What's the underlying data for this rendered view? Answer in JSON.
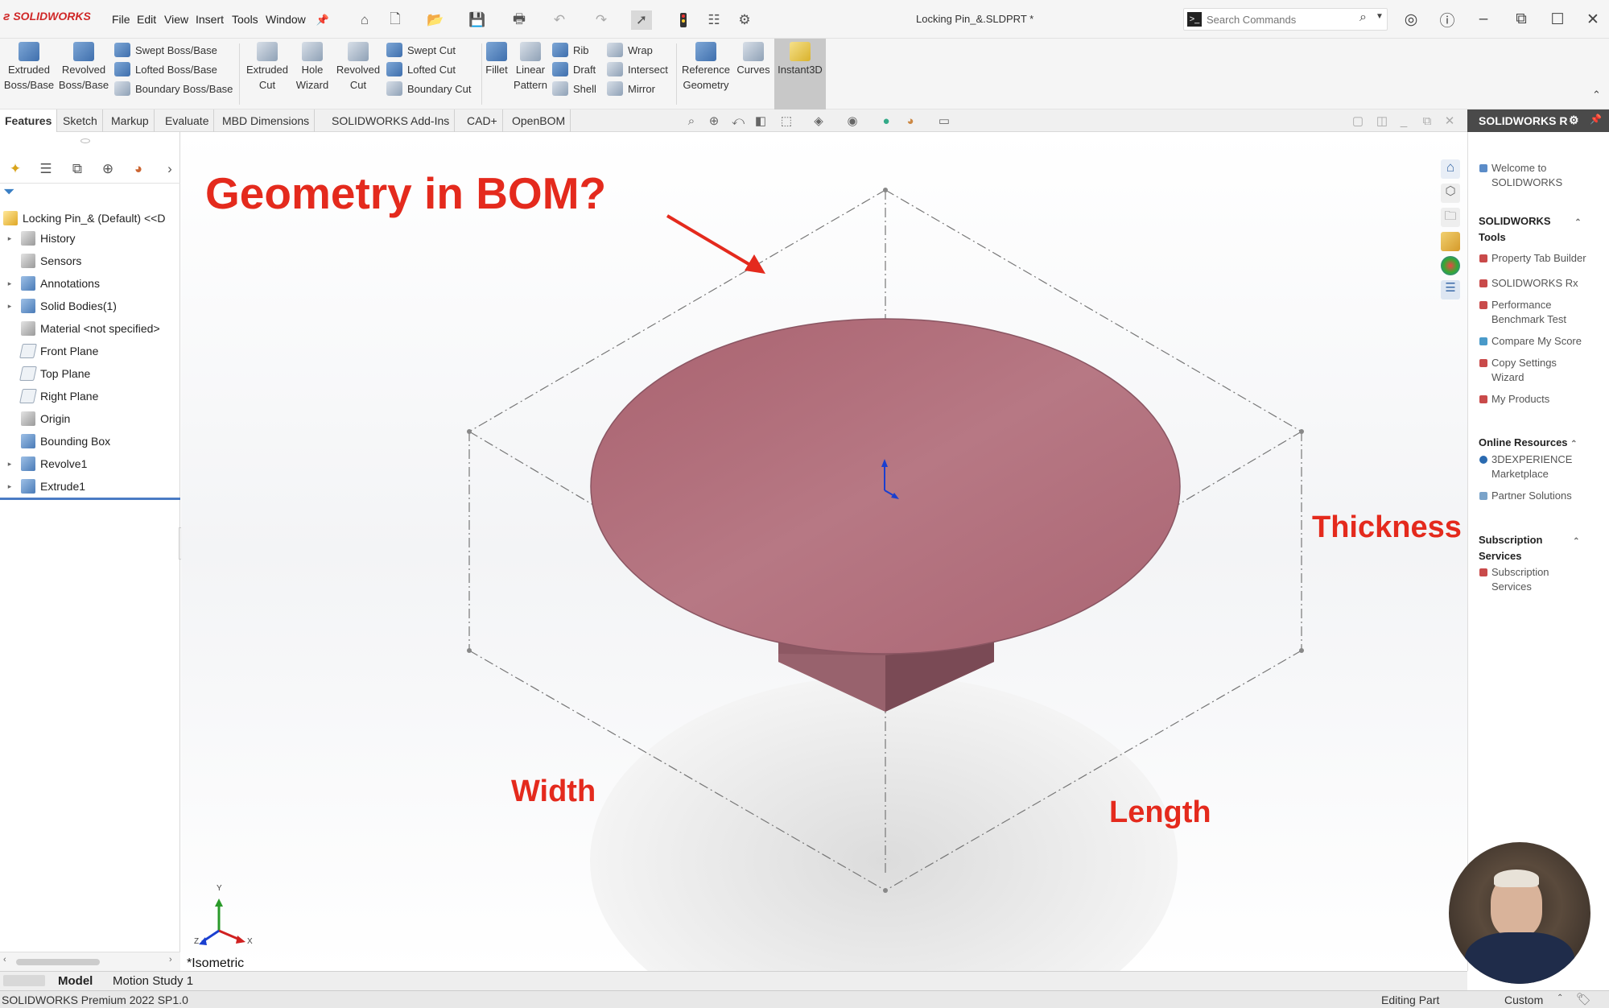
{
  "app": {
    "logo": "SOLIDWORKS",
    "doc_title": "Locking Pin_&.SLDPRT *"
  },
  "menu": [
    "File",
    "Edit",
    "View",
    "Insert",
    "Tools",
    "Window"
  ],
  "search": {
    "placeholder": "Search Commands"
  },
  "ribbon": {
    "extruded_boss": [
      "Extruded",
      "Boss/Base"
    ],
    "revolved_boss": [
      "Revolved",
      "Boss/Base"
    ],
    "swept_boss": "Swept Boss/Base",
    "lofted_boss": "Lofted Boss/Base",
    "boundary_boss": "Boundary Boss/Base",
    "extruded_cut": [
      "Extruded",
      "Cut"
    ],
    "hole_wizard": [
      "Hole",
      "Wizard"
    ],
    "revolved_cut": [
      "Revolved",
      "Cut"
    ],
    "swept_cut": "Swept Cut",
    "lofted_cut": "Lofted Cut",
    "boundary_cut": "Boundary Cut",
    "fillet": "Fillet",
    "linear_pattern": [
      "Linear",
      "Pattern"
    ],
    "rib": "Rib",
    "draft": "Draft",
    "shell": "Shell",
    "wrap": "Wrap",
    "intersect": "Intersect",
    "mirror": "Mirror",
    "reference_geometry": [
      "Reference",
      "Geometry"
    ],
    "curves": "Curves",
    "instant3d": "Instant3D"
  },
  "tabs": [
    "Features",
    "Sketch",
    "Markup",
    "Evaluate",
    "MBD Dimensions",
    "SOLIDWORKS Add-Ins",
    "CAD+",
    "OpenBOM"
  ],
  "tree": {
    "root": "Locking Pin_& (Default) <<D",
    "items": [
      {
        "label": "History",
        "expand": true
      },
      {
        "label": "Sensors",
        "expand": false
      },
      {
        "label": "Annotations",
        "expand": true
      },
      {
        "label": "Solid Bodies(1)",
        "expand": true
      },
      {
        "label": "Material <not specified>",
        "expand": false
      },
      {
        "label": "Front Plane",
        "expand": false
      },
      {
        "label": "Top Plane",
        "expand": false
      },
      {
        "label": "Right Plane",
        "expand": false
      },
      {
        "label": "Origin",
        "expand": false
      },
      {
        "label": "Bounding Box",
        "expand": false
      },
      {
        "label": "Revolve1",
        "expand": true
      },
      {
        "label": "Extrude1",
        "expand": true
      }
    ]
  },
  "annotations": {
    "title": "Geometry in BOM?",
    "thickness": "Thickness",
    "width": "Width",
    "length": "Length"
  },
  "viewport": {
    "view_name": "*Isometric",
    "triad": {
      "x": "X",
      "y": "Y",
      "z": "Z"
    }
  },
  "taskpane": {
    "title": "SOLIDWORKS R",
    "welcome": [
      "Welcome to",
      "SOLIDWORKS"
    ],
    "tools_head": [
      "SOLIDWORKS",
      "Tools"
    ],
    "tools": [
      [
        "Property Tab Builder"
      ],
      [
        "SOLIDWORKS Rx"
      ],
      [
        "Performance",
        "Benchmark Test"
      ],
      [
        "Compare My Score"
      ],
      [
        "Copy Settings",
        "Wizard"
      ],
      [
        "My Products"
      ]
    ],
    "online_head": "Online Resources",
    "online": [
      [
        "3DEXPERIENCE",
        "Marketplace"
      ],
      [
        "Partner Solutions"
      ]
    ],
    "subs_head": [
      "Subscription",
      "Services"
    ],
    "subs": [
      [
        "Subscription",
        "Services"
      ]
    ]
  },
  "bottom_tabs": [
    "Model",
    "Motion Study 1"
  ],
  "status": {
    "left": "SOLIDWORKS Premium 2022 SP1.0",
    "mode": "Editing Part",
    "units": "Custom"
  },
  "colors": {
    "annotation": "#e42a1d",
    "part": "#b5717f",
    "brand": "#d02828"
  }
}
